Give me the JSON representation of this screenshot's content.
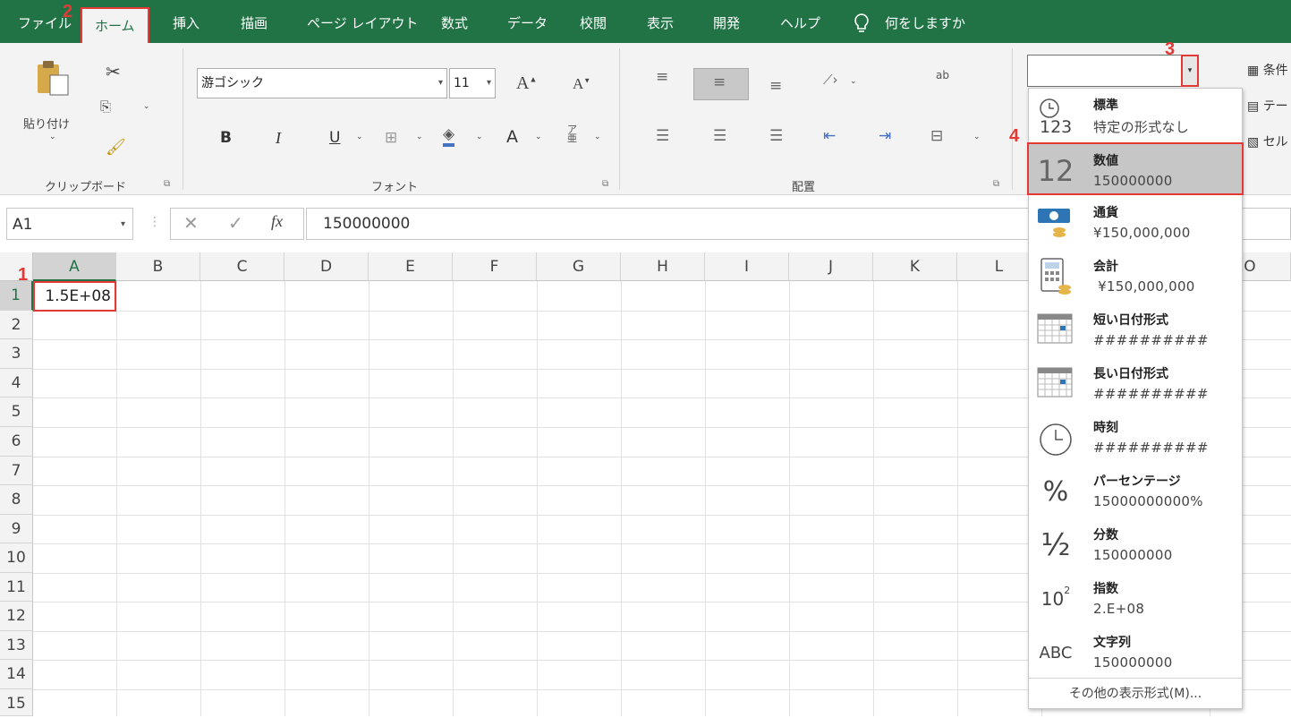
{
  "tabs": {
    "file": "ファイル",
    "home": "ホーム",
    "insert": "挿入",
    "draw": "描画",
    "page_layout": "ページ レイアウト",
    "formulas": "数式",
    "data": "データ",
    "review": "校閲",
    "view": "表示",
    "developer": "開発",
    "help": "ヘルプ",
    "tell_me": "何をしますか"
  },
  "ribbon": {
    "paste_label": "貼り付け",
    "clipboard_group": "クリップボード",
    "font_name": "游ゴシック",
    "font_size": "11",
    "font_group": "フォント",
    "bold": "B",
    "italic": "I",
    "underline": "U",
    "font_color_letter": "A",
    "align_group": "配置",
    "wrap_text_glyph": "ab",
    "right_partial_1": "条件",
    "right_partial_2": "テー",
    "right_partial_3": "セル"
  },
  "formula_bar": {
    "name_box": "A1",
    "formula_value": "150000000"
  },
  "grid": {
    "columns": [
      "A",
      "B",
      "C",
      "D",
      "E",
      "F",
      "G",
      "H",
      "I",
      "J",
      "K",
      "L",
      "O"
    ],
    "rows": [
      "1",
      "2",
      "3",
      "4",
      "5",
      "6",
      "7",
      "8",
      "9",
      "10",
      "11",
      "12",
      "13",
      "14",
      "15"
    ],
    "cell_a1": "1.5E+08"
  },
  "callouts": {
    "c1": "1",
    "c2": "2",
    "c3": "3",
    "c4": "4"
  },
  "number_format_menu": {
    "items": [
      {
        "name": "標準",
        "value": "特定の形式なし",
        "icon": "clock-123-icon"
      },
      {
        "name": "数値",
        "value": "150000000",
        "icon": "number-12-icon"
      },
      {
        "name": "通貨",
        "value": "¥150,000,000",
        "icon": "currency-icon"
      },
      {
        "name": "会計",
        "value": " ¥150,000,000",
        "icon": "accounting-icon"
      },
      {
        "name": "短い日付形式",
        "value": "##########",
        "icon": "calendar-short-icon"
      },
      {
        "name": "長い日付形式",
        "value": "##########",
        "icon": "calendar-long-icon"
      },
      {
        "name": "時刻",
        "value": "##########",
        "icon": "clock-icon"
      },
      {
        "name": "パーセンテージ",
        "value": "15000000000%",
        "icon": "percent-icon"
      },
      {
        "name": "分数",
        "value": "150000000",
        "icon": "fraction-icon"
      },
      {
        "name": "指数",
        "value": "2.E+08",
        "icon": "scientific-icon"
      },
      {
        "name": "文字列",
        "value": "150000000",
        "icon": "text-abc-icon"
      }
    ],
    "icon_text": {
      "standard": "123",
      "number": "12",
      "percent": "%",
      "fraction": "½",
      "scientific_base": "10",
      "scientific_exp": "2",
      "text": "ABC"
    },
    "more_formats": "その他の表示形式(M)..."
  },
  "colors": {
    "excel_green": "#217346",
    "highlight_red": "#e53935"
  }
}
